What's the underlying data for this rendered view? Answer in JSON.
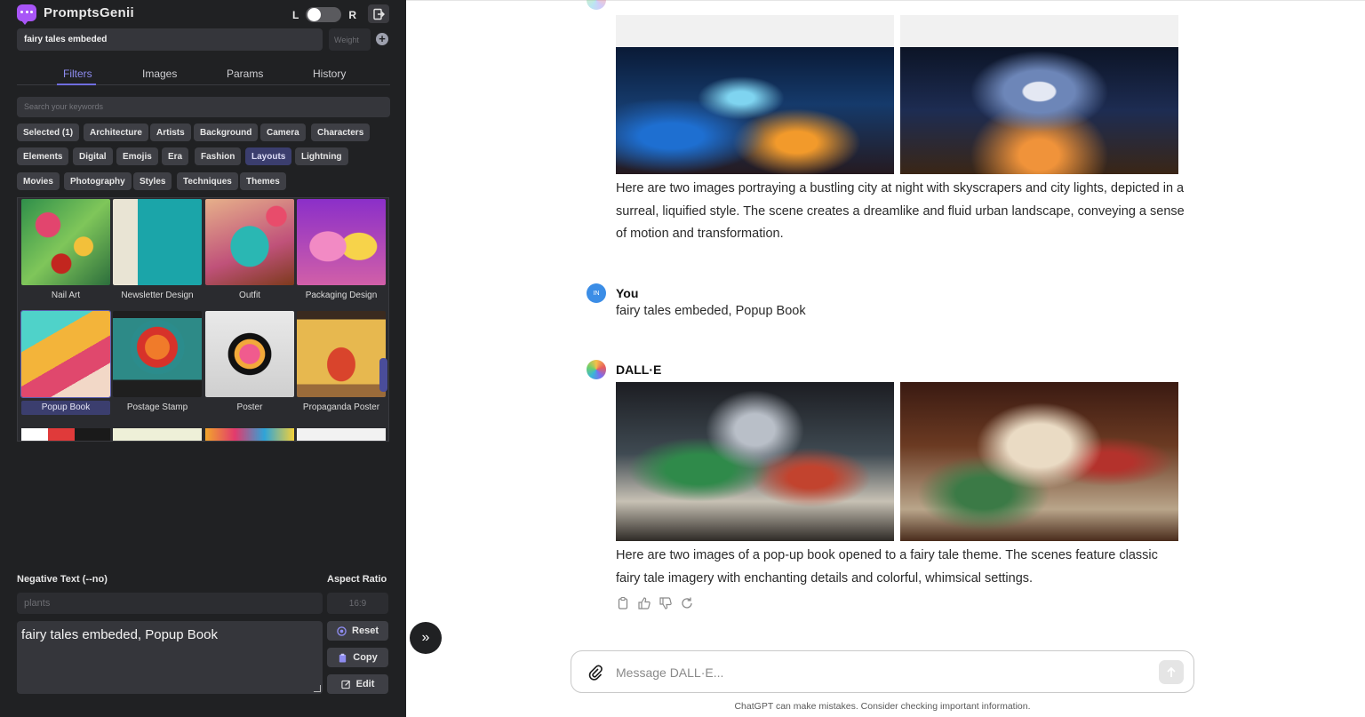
{
  "panel": {
    "brand_name": "PromptsGenii",
    "toggle_left": "L",
    "toggle_right": "R",
    "prompt_value": "fairy tales embeded",
    "weight_placeholder": "Weight",
    "tabs": [
      "Filters",
      "Images",
      "Params",
      "History"
    ],
    "active_tab": "Filters",
    "search_placeholder": "Search your keywords",
    "chips_row1": [
      "Selected (1)",
      "Architecture",
      "Artists",
      "Background",
      "Camera",
      "Characters"
    ],
    "chips_row2": [
      "Elements",
      "Digital",
      "Emojis",
      "Era",
      "Fashion",
      "Layouts",
      "Lightning"
    ],
    "chips_row3": [
      "Movies",
      "Photography",
      "Styles",
      "Techniques",
      "Themes"
    ],
    "selected_chip": "Layouts",
    "gallery": [
      {
        "label": "Nail Art"
      },
      {
        "label": "Newsletter Design"
      },
      {
        "label": "Outfit"
      },
      {
        "label": "Packaging Design"
      },
      {
        "label": "Popup Book",
        "selected": true
      },
      {
        "label": "Postage Stamp"
      },
      {
        "label": "Poster"
      },
      {
        "label": "Propaganda Poster"
      }
    ],
    "neg_label": "Negative Text (--no)",
    "neg_placeholder": "plants",
    "ar_label": "Aspect Ratio",
    "ar_placeholder": "16:9",
    "final_prompt": "fairy tales embeded, Popup Book",
    "btn_reset": "Reset",
    "btn_copy": "Copy",
    "btn_edit": "Edit"
  },
  "chat": {
    "message1_text": "Here are two images portraying a bustling city at night with skyscrapers and city lights, depicted in a surreal, liquified style. The scene creates a dreamlike and fluid urban landscape, conveying a sense of motion and transformation.",
    "user_avatar": "IN",
    "user_name": "You",
    "user_message": "fairy tales embeded, Popup Book",
    "bot_name": "DALL·E",
    "message2_text": "Here are two images of a pop-up book opened to a fairy tale theme. The scenes feature classic fairy tale imagery with enchanting details and colorful, whimsical settings.",
    "composer_placeholder": "Message DALL·E...",
    "disclaimer": "ChatGPT can make mistakes. Consider checking important information."
  },
  "colors": {
    "panel_bg": "#202123",
    "accent": "#6f6ddf",
    "chip_bg": "#3e3f45",
    "chip_selected": "#3b3e6e",
    "user_avatar": "#3b8de6"
  }
}
